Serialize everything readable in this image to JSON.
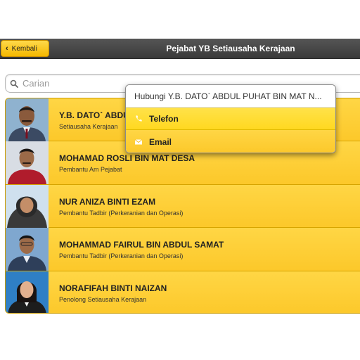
{
  "header": {
    "back_label": "Kembali",
    "title": "Pejabat YB Setiausaha Kerajaan"
  },
  "search": {
    "placeholder": "Carian",
    "value": ""
  },
  "staff": [
    {
      "name": "Y.B. DATO` ABDUL PUHAT BIN MAT NAYAN",
      "role": "Setiausaha Kerajaan"
    },
    {
      "name": "MOHAMAD ROSLI BIN MAT DESA",
      "role": "Pembantu Am Pejabat"
    },
    {
      "name": "NUR ANIZA BINTI EZAM",
      "role": "Pembantu Tadbir (Perkeranian dan Operasi)"
    },
    {
      "name": "MOHAMMAD FAIRUL BIN ABDUL SAMAT",
      "role": "Pembantu Tadbir (Perkeranian dan Operasi)"
    },
    {
      "name": "NORAFIFAH BINTI NAIZAN",
      "role": "Penolong Setiausaha Kerajaan"
    }
  ],
  "popup": {
    "title": "Hubungi Y.B. DATO` ABDUL PUHAT BIN MAT N...",
    "phone_label": "Telefon",
    "email_label": "Email"
  },
  "colors": {
    "accent": "#fcc82a",
    "header": "#3a3a3a"
  },
  "icons": [
    "chevron-left-icon",
    "search-icon",
    "phone-icon",
    "mail-icon"
  ]
}
